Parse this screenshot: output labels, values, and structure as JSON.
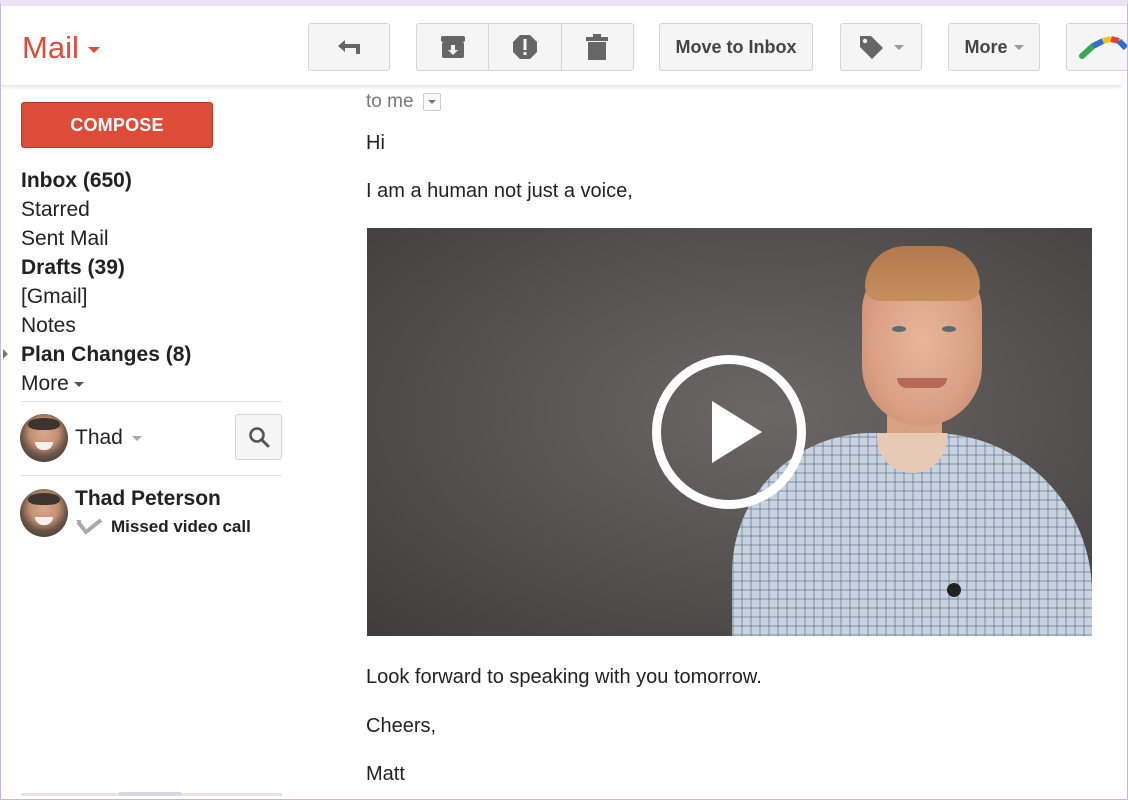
{
  "app": {
    "title": "Mail",
    "brand_color": "#dd4b39"
  },
  "toolbar": {
    "reply_icon": "reply-icon",
    "archive_icon": "archive-icon",
    "spam_icon": "report-spam-icon",
    "delete_icon": "trash-icon",
    "move_to_inbox_label": "Move to Inbox",
    "labels_icon": "label-tag-icon",
    "more_label": "More",
    "extension_icon": "boomerang-icon"
  },
  "sidebar": {
    "compose_label": "COMPOSE",
    "items": [
      {
        "label": "Inbox (650)",
        "bold": true
      },
      {
        "label": "Starred",
        "bold": false
      },
      {
        "label": "Sent Mail",
        "bold": false
      },
      {
        "label": "Drafts (39)",
        "bold": true
      },
      {
        "label": "[Gmail]",
        "bold": false
      },
      {
        "label": "Notes",
        "bold": false
      },
      {
        "label": "Plan Changes (8)",
        "bold": true,
        "expandable": true
      },
      {
        "label": "More",
        "bold": false
      }
    ],
    "hangouts": {
      "me_name": "Thad",
      "search_icon": "search-icon",
      "contacts": [
        {
          "name": "Thad Peterson",
          "status": "Missed video call"
        }
      ]
    }
  },
  "message": {
    "recipient_label": "to me",
    "body": [
      "Hi",
      "I am a human not just a voice,",
      "Look forward to speaking with you tomorrow.",
      "Cheers,",
      "Matt"
    ],
    "video": {
      "play_icon": "play-icon"
    }
  }
}
